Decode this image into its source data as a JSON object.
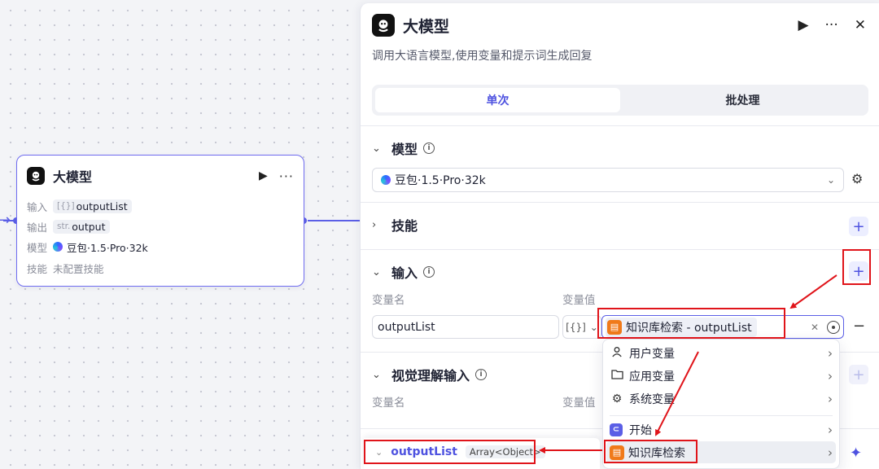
{
  "canvas": {
    "node": {
      "title": "大模型",
      "play_icon": "▶",
      "more_icon": "···",
      "rows": [
        {
          "label": "输入",
          "tag": "[{}]",
          "value": "outputList"
        },
        {
          "label": "输出",
          "tag": "str.",
          "value": "output"
        },
        {
          "label": "模型",
          "value": "豆包·1.5·Pro·32k"
        },
        {
          "label": "技能",
          "value": "未配置技能"
        }
      ]
    }
  },
  "panel": {
    "title": "大模型",
    "description": "调用大语言模型,使用变量和提示词生成回复",
    "tabs": [
      {
        "label": "单次"
      },
      {
        "label": "批处理"
      }
    ],
    "sections": {
      "model": {
        "title": "模型",
        "selected": "豆包·1.5·Pro·32k"
      },
      "skills": {
        "title": "技能"
      },
      "input": {
        "title": "输入",
        "col_name": "变量名",
        "col_value": "变量值",
        "var_name": "outputList",
        "type_short": "[{}]",
        "ref": "知识库检索 - outputList"
      },
      "vision": {
        "title": "视觉理解输入",
        "col_name": "变量名",
        "col_value": "变量值"
      }
    }
  },
  "dropdown": {
    "items": [
      {
        "icon": "user-icon",
        "label": "用户变量"
      },
      {
        "icon": "folder-icon",
        "label": "应用变量"
      },
      {
        "icon": "gear-icon",
        "label": "系统变量"
      },
      {
        "icon": "start-icon",
        "label": "开始"
      },
      {
        "icon": "knowledge-icon",
        "label": "知识库检索"
      }
    ]
  },
  "output_popover": {
    "name": "outputList",
    "type": "Array<Object>"
  },
  "colors": {
    "accent": "#5b5fe6",
    "annotation_red": "#e0141a",
    "knowledge_orange": "#f07a1a"
  }
}
